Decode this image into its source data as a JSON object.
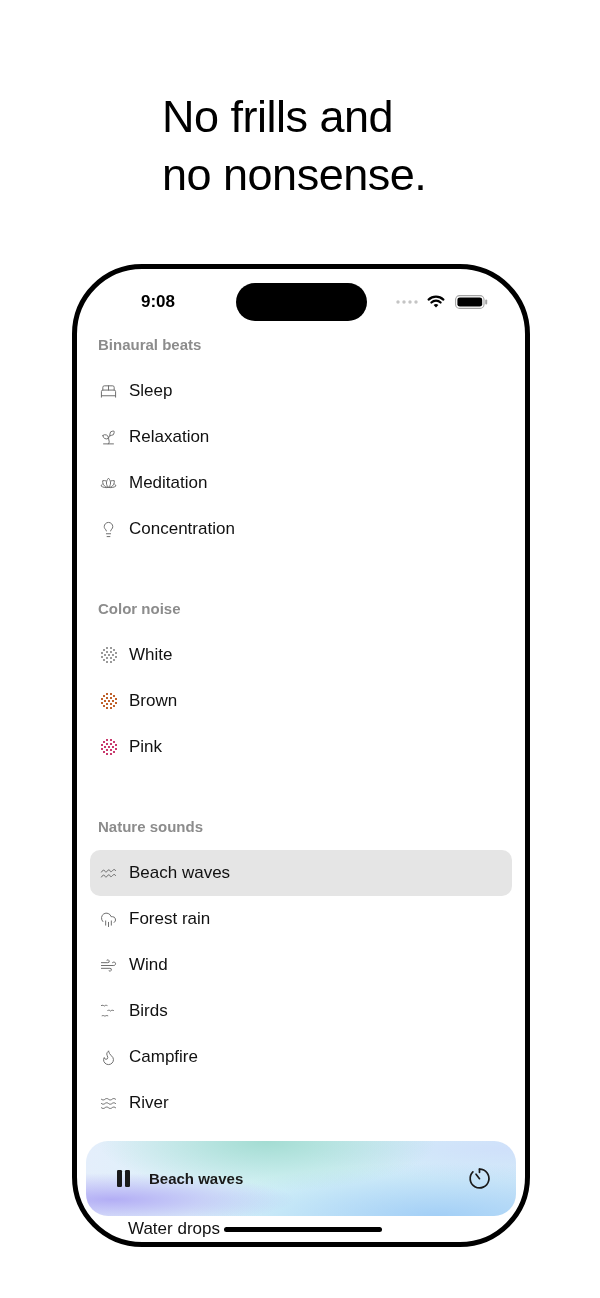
{
  "headline": "No frills and no nonsense.",
  "status_bar": {
    "time": "9:08"
  },
  "sections": [
    {
      "title": "Binaural beats",
      "items": [
        {
          "label": "Sleep",
          "selected": false
        },
        {
          "label": "Relaxation",
          "selected": false
        },
        {
          "label": "Meditation",
          "selected": false
        },
        {
          "label": "Concentration",
          "selected": false
        }
      ]
    },
    {
      "title": "Color noise",
      "items": [
        {
          "label": "White",
          "selected": false,
          "color": "#9a9a9a"
        },
        {
          "label": "Brown",
          "selected": false,
          "color": "#c0612b"
        },
        {
          "label": "Pink",
          "selected": false,
          "color": "#c93a6e"
        }
      ]
    },
    {
      "title": "Nature sounds",
      "items": [
        {
          "label": "Beach waves",
          "selected": true
        },
        {
          "label": "Forest rain",
          "selected": false
        },
        {
          "label": "Wind",
          "selected": false
        },
        {
          "label": "Birds",
          "selected": false
        },
        {
          "label": "Campfire",
          "selected": false
        },
        {
          "label": "River",
          "selected": false
        },
        {
          "label": "Water drops",
          "selected": false
        }
      ]
    }
  ],
  "player": {
    "title": "Beach waves",
    "playing": true
  }
}
